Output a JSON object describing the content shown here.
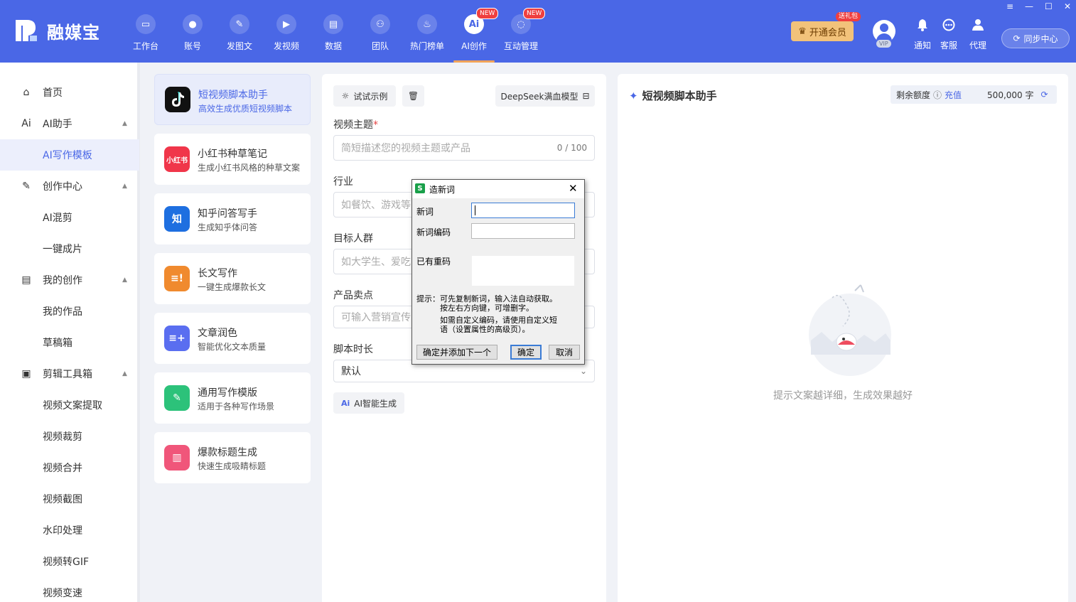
{
  "app": {
    "name": "融媒宝"
  },
  "nav": [
    {
      "label": "工作台",
      "icon": "monitor-icon"
    },
    {
      "label": "账号",
      "icon": "user-icon"
    },
    {
      "label": "发图文",
      "icon": "feather-icon"
    },
    {
      "label": "发视频",
      "icon": "play-icon"
    },
    {
      "label": "数据",
      "icon": "chart-icon"
    },
    {
      "label": "团队",
      "icon": "team-icon"
    },
    {
      "label": "热门榜单",
      "icon": "fire-icon"
    },
    {
      "label": "AI创作",
      "icon": "ai-icon",
      "badge": "NEW",
      "active": true
    },
    {
      "label": "互动管理",
      "icon": "chat-icon",
      "badge": "NEW"
    }
  ],
  "header": {
    "vip_label": "开通会员",
    "gift_badge": "送礼包",
    "vip_tag": "VIP",
    "notify_label": "通知",
    "service_label": "客服",
    "agent_label": "代理",
    "sync_label": "同步中心",
    "window_controls": [
      "≡",
      "—",
      "☐",
      "✕"
    ]
  },
  "sidebar": [
    {
      "label": "首页",
      "icon": "home-icon",
      "level": 1
    },
    {
      "label": "AI助手",
      "icon": "ai-text-icon",
      "level": 1,
      "expandable": true
    },
    {
      "label": "AI写作模板",
      "level": 2,
      "active": true
    },
    {
      "label": "创作中心",
      "icon": "pen-icon",
      "level": 1,
      "expandable": true
    },
    {
      "label": "AI混剪",
      "level": 2
    },
    {
      "label": "一键成片",
      "level": 2
    },
    {
      "label": "我的创作",
      "icon": "document-icon",
      "level": 1,
      "expandable": true
    },
    {
      "label": "我的作品",
      "level": 2
    },
    {
      "label": "草稿箱",
      "level": 2
    },
    {
      "label": "剪辑工具箱",
      "icon": "toolbox-icon",
      "level": 1,
      "expandable": true
    },
    {
      "label": "视频文案提取",
      "level": 2
    },
    {
      "label": "视频裁剪",
      "level": 2
    },
    {
      "label": "视频合并",
      "level": 2
    },
    {
      "label": "视频截图",
      "level": 2
    },
    {
      "label": "水印处理",
      "level": 2
    },
    {
      "label": "视频转GIF",
      "level": 2
    },
    {
      "label": "视频变速",
      "level": 2
    }
  ],
  "templates": [
    {
      "title": "短视频脚本助手",
      "desc": "高效生成优质短视频脚本",
      "icon": "tiktok-icon",
      "color": "#111111",
      "active": true
    },
    {
      "title": "小红书种草笔记",
      "desc": "生成小红书风格的种草文案",
      "icon": "xiaohongshu-icon",
      "glyph": "小红书",
      "color": "#f0364a"
    },
    {
      "title": "知乎问答写手",
      "desc": "生成知乎体问答",
      "icon": "zhihu-icon",
      "glyph": "知",
      "color": "#1e6fe0"
    },
    {
      "title": "长文写作",
      "desc": "一键生成爆款长文",
      "icon": "longtext-icon",
      "glyph": "≡!",
      "color": "#f08a2e"
    },
    {
      "title": "文章润色",
      "desc": "智能优化文本质量",
      "icon": "polish-icon",
      "glyph": "≡+",
      "color": "#5a6ef0"
    },
    {
      "title": "通用写作模版",
      "desc": "适用于各种写作场景",
      "icon": "edit-icon",
      "glyph": "✎",
      "color": "#2cc27a"
    },
    {
      "title": "爆款标题生成",
      "desc": "快速生成吸睛标题",
      "icon": "book-icon",
      "glyph": "▥",
      "color": "#f0567a"
    }
  ],
  "form": {
    "example_btn": "试试示例",
    "model_btn": "DeepSeek满血模型",
    "fields": [
      {
        "label": "视频主题",
        "required": true,
        "placeholder": "简短描述您的视频主题或产品",
        "counter": "0 / 100"
      },
      {
        "label": "行业",
        "placeholder": "如餐饮、游戏等"
      },
      {
        "label": "目标人群",
        "placeholder": "如大学生、爱吃"
      },
      {
        "label": "产品卖点",
        "placeholder": "可输入营销宣传"
      },
      {
        "label": "脚本时长",
        "value": "默认"
      }
    ],
    "generate_btn": "AI智能生成"
  },
  "result": {
    "title": "短视频脚本助手",
    "quota_label": "剩余额度",
    "recharge_label": "充值",
    "quota_value": "500,000 字",
    "empty_text": "提示文案越详细，生成效果越好"
  },
  "dialog": {
    "title": "造新词",
    "new_word_label": "新词",
    "new_word_value": "",
    "code_label": "新词编码",
    "code_value": "",
    "existing_label": "已有重码",
    "hint_lines": [
      "提示：可先复制新词，输入法自动获取。",
      "　　　按左右方向键，可增删字。",
      "",
      "　　　如需自定义编码，请使用自定义短",
      "　　　语（设置属性的高级页）。"
    ],
    "btn_confirm_next": "确定并添加下一个",
    "btn_ok": "确定",
    "btn_cancel": "取消"
  }
}
